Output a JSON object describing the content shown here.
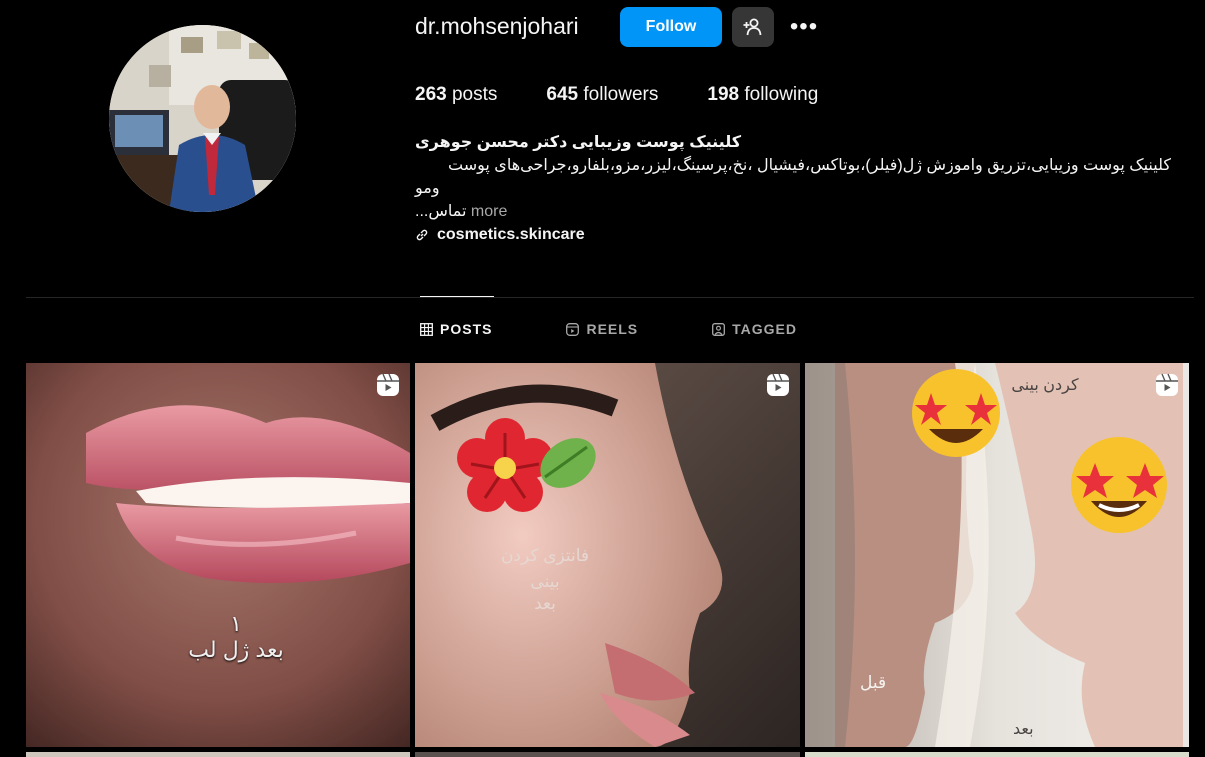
{
  "profile": {
    "username": "dr.mohsenjohari",
    "follow_label": "Follow",
    "more_label": "•••",
    "stats": {
      "posts_count": "263",
      "posts_label": "posts",
      "followers_count": "645",
      "followers_label": "followers",
      "following_count": "198",
      "following_label": "following"
    },
    "bio": {
      "name": "کلینیک پوست وزیبایی دکتر محسن جوهری",
      "line1": "کلینیک پوست وزیبایی،تزریق واموزش ژل(فیلر)،بوتاکس،فیشیال ،نخ،پرسینگ،لیزر،مزو،بلفارو،جراحی‌های پوست",
      "line2": "ومو",
      "line3": "تماس...",
      "more": "more",
      "link": "cosmetics.skincare"
    }
  },
  "tabs": [
    {
      "label": "POSTS",
      "icon": "grid-icon",
      "active": true
    },
    {
      "label": "REELS",
      "icon": "reels-icon",
      "active": false
    },
    {
      "label": "TAGGED",
      "icon": "tagged-icon",
      "active": false
    }
  ],
  "posts": [
    {
      "caption1": "١",
      "caption2": "بعد ژل لب",
      "icon": "reel-icon"
    },
    {
      "caption1": "فانتزی کردن",
      "caption2": "بینی",
      "caption3": "بعد",
      "icon": "reel-icon"
    },
    {
      "caption_top": "کردن بینی",
      "caption_before": "قبل",
      "caption_after": "بعد",
      "icon": "reel-icon"
    }
  ],
  "colors": {
    "background": "#000000",
    "follow_button": "#0095f6",
    "secondary_button": "#363636",
    "muted_text": "#a8a8a8",
    "divider": "#262626"
  }
}
